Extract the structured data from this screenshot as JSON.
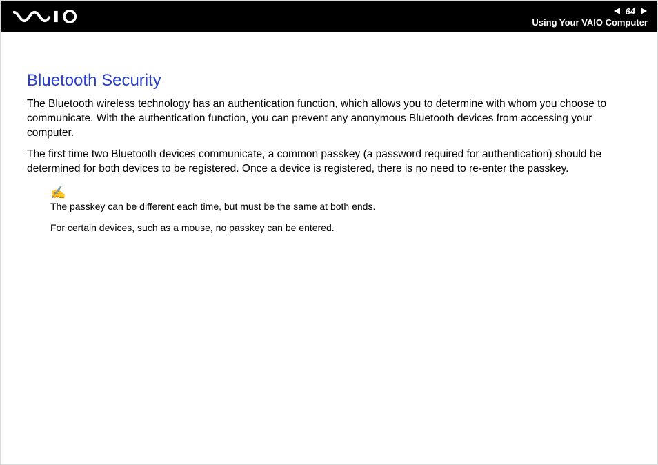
{
  "header": {
    "page_number": "64",
    "section": "Using Your VAIO Computer"
  },
  "title": "Bluetooth Security",
  "paragraphs": [
    "The Bluetooth wireless technology has an authentication function, which allows you to determine with whom you choose to communicate. With the authentication function, you can prevent any anonymous Bluetooth devices from accessing your computer.",
    "The first time two Bluetooth devices communicate, a common passkey (a password required for authentication) should be determined for both devices to be registered. Once a device is registered, there is no need to re-enter the passkey."
  ],
  "note_icon": "✍",
  "notes": [
    "The passkey can be different each time, but must be the same at both ends.",
    "For certain devices, such as a mouse, no passkey can be entered."
  ]
}
